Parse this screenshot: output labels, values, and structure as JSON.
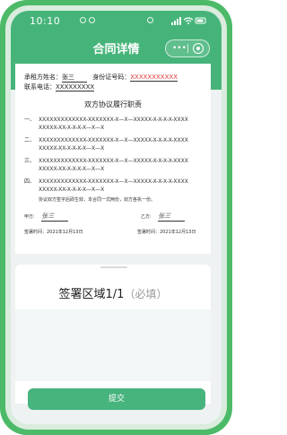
{
  "status": {
    "time": "10:10"
  },
  "nav": {
    "title": "合同详情",
    "more_icon": "•••"
  },
  "doc": {
    "party_label": "承租方姓名：",
    "party_name": "张三",
    "id_label": "身份证号码：",
    "id_value": "XXXXXXXXXXX",
    "phone_label": "联系电话：",
    "phone_value": "XXXXXXXXX",
    "section_title": "双方协议履行职责",
    "items": [
      {
        "num": "一、",
        "line1": "XXXXXXXXXXXXX-XXXXXXX-X—X—XXXXX-X-X-X-X-XXXX",
        "line2": "XXXXX-XX-X-X-X-X—X—X"
      },
      {
        "num": "二、",
        "line1": "XXXXXXXXXXXXX-XXXXXXX-X—X—XXXXX-X-X-X-X-XXXX",
        "line2": "XXXXX-XX-X-X-X-X—X—X"
      },
      {
        "num": "三、",
        "line1": "XXXXXXXXXXXXX-XXXXXXX-X—X—XXXXX-X-X-X-X-XXXX",
        "line2": "XXXXX-XX-X-X-X-X—X—X"
      },
      {
        "num": "四、",
        "line1": "XXXXXXXXXXXXX-XXXXXXX-X—X—XXXXX-X-X-X-X-XXXX",
        "line2": "XXXXX-XX-X-X-X-X—X—X"
      }
    ],
    "note": "协议双方签字后即生效，本合同一式两份，双方各执一份。",
    "party_a_label": "甲方:",
    "party_a_sign": "张三",
    "party_b_label": "乙方:",
    "party_b_sign": "张三",
    "date_a": "签署时间：2021年12月13日",
    "date_b": "签署时间：2021年12月13日"
  },
  "sign_panel": {
    "title": "签署区域1/1",
    "required": "（必填）"
  },
  "submit_label": "提交",
  "colors": {
    "primary": "#46b47a",
    "frame": "#4cba68",
    "accent_red": "#e03a3a"
  }
}
